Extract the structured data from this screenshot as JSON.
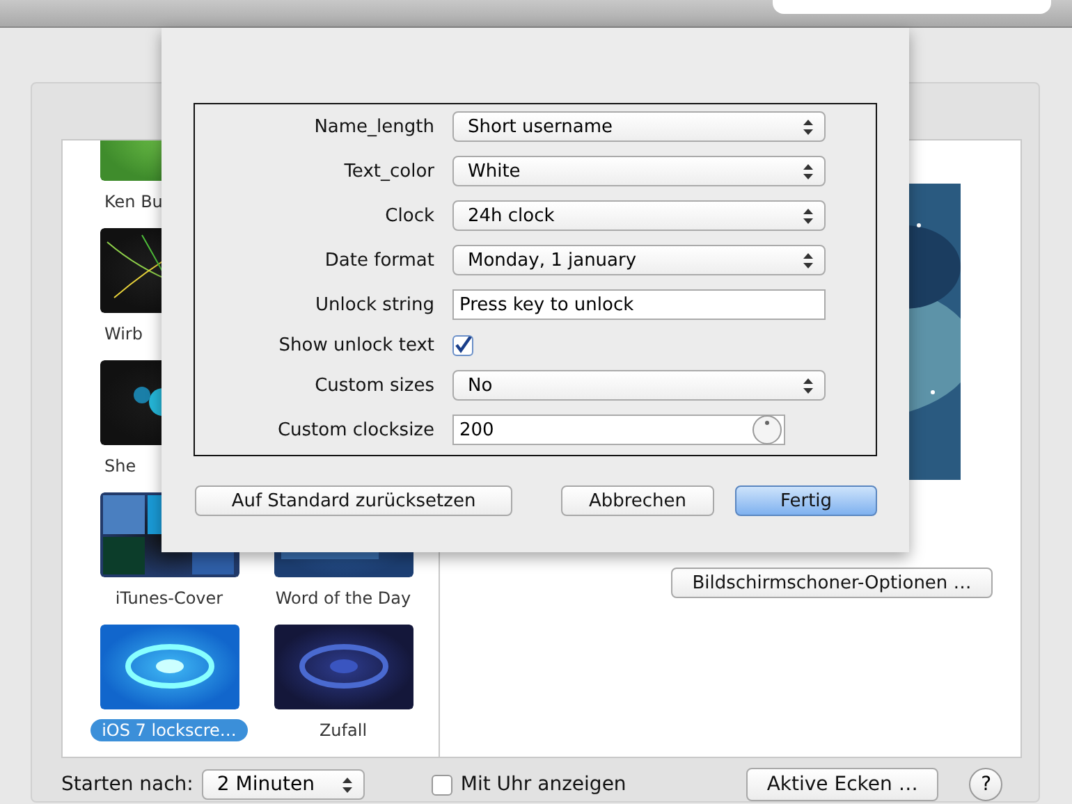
{
  "thumbnails": [
    {
      "label": "Ken Bu",
      "covered": true,
      "selected": false
    },
    {
      "label": "Wirb",
      "covered": true,
      "selected": false
    },
    {
      "label": "She",
      "covered": true,
      "selected": false
    },
    {
      "label": "iTunes-Cover",
      "covered": false,
      "selected": false
    },
    {
      "label": "Word of the Day",
      "covered": false,
      "selected": false
    },
    {
      "label": "iOS 7 lockscre…",
      "covered": false,
      "selected": true
    },
    {
      "label": "Zufall",
      "covered": false,
      "selected": false
    }
  ],
  "options_button": "Bildschirmschoner-Optionen …",
  "footer": {
    "start_label": "Starten nach:",
    "start_value": "2 Minuten",
    "clock_label": "Mit Uhr anzeigen",
    "clock_checked": false,
    "corners_button": "Aktive Ecken …",
    "help": "?"
  },
  "sheet": {
    "rows": [
      {
        "kind": "popup",
        "label": "Name_length",
        "value": "Short username"
      },
      {
        "kind": "popup",
        "label": "Text_color",
        "value": "White"
      },
      {
        "kind": "popup",
        "label": "Clock",
        "value": "24h clock"
      },
      {
        "kind": "popup",
        "label": "Date format",
        "value": "Monday, 1 january"
      },
      {
        "kind": "text",
        "label": "Unlock string",
        "value": "Press key to unlock"
      },
      {
        "kind": "checkbox",
        "label": "Show unlock text",
        "checked": true
      },
      {
        "kind": "popup",
        "label": "Custom sizes",
        "value": "No"
      },
      {
        "kind": "number",
        "label": "Custom clocksize",
        "value": "200"
      }
    ],
    "buttons": [
      {
        "label": "Auf Standard zurücksetzen",
        "default": false
      },
      {
        "label": "Abbrechen",
        "default": false
      },
      {
        "label": "Fertig",
        "default": true
      }
    ]
  }
}
